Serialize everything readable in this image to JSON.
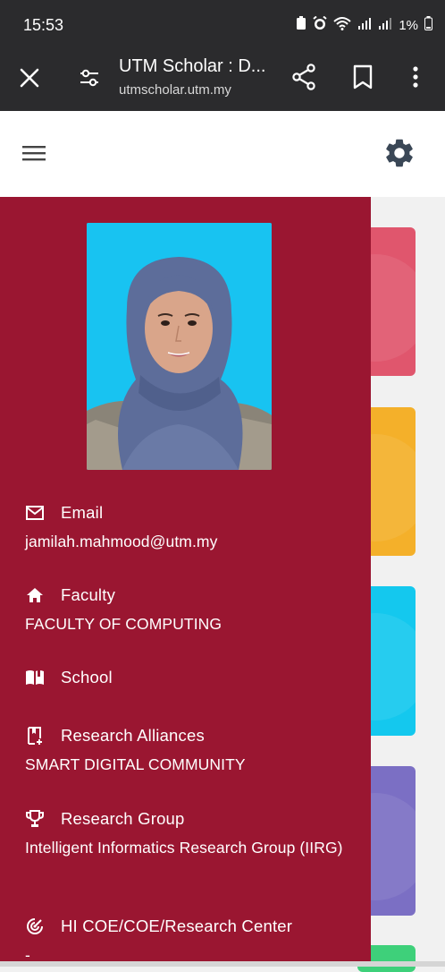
{
  "status_bar": {
    "time": "15:53",
    "battery": "1%"
  },
  "browser": {
    "title": "UTM Scholar : D...",
    "url": "utmscholar.utm.my"
  },
  "profile": {
    "fields": [
      {
        "label": "Email",
        "value": "jamilah.mahmood@utm.my"
      },
      {
        "label": "Faculty",
        "value": "FACULTY OF COMPUTING"
      },
      {
        "label": "School",
        "value": ""
      },
      {
        "label": "Research Alliances",
        "value": "SMART DIGITAL COMMUNITY"
      },
      {
        "label": "Research Group",
        "value": "Intelligent Informatics Research Group (IIRG)"
      },
      {
        "label": "HI COE/COE/Research Center",
        "value": "-"
      }
    ]
  },
  "colors": {
    "drawer": "#9a1631",
    "card_1": "#e0566d",
    "card_2": "#f4b02a",
    "card_3": "#14c8ee",
    "card_4": "#7b6fc4",
    "card_5": "#3ed07a"
  },
  "icons": [
    "close-icon",
    "tune-icon",
    "share-icon",
    "bookmark-icon",
    "more-vert-icon",
    "menu-icon",
    "gear-icon",
    "mail-icon",
    "home-icon",
    "book-icon",
    "bookmark-plus-icon",
    "trophy-icon",
    "target-icon"
  ]
}
